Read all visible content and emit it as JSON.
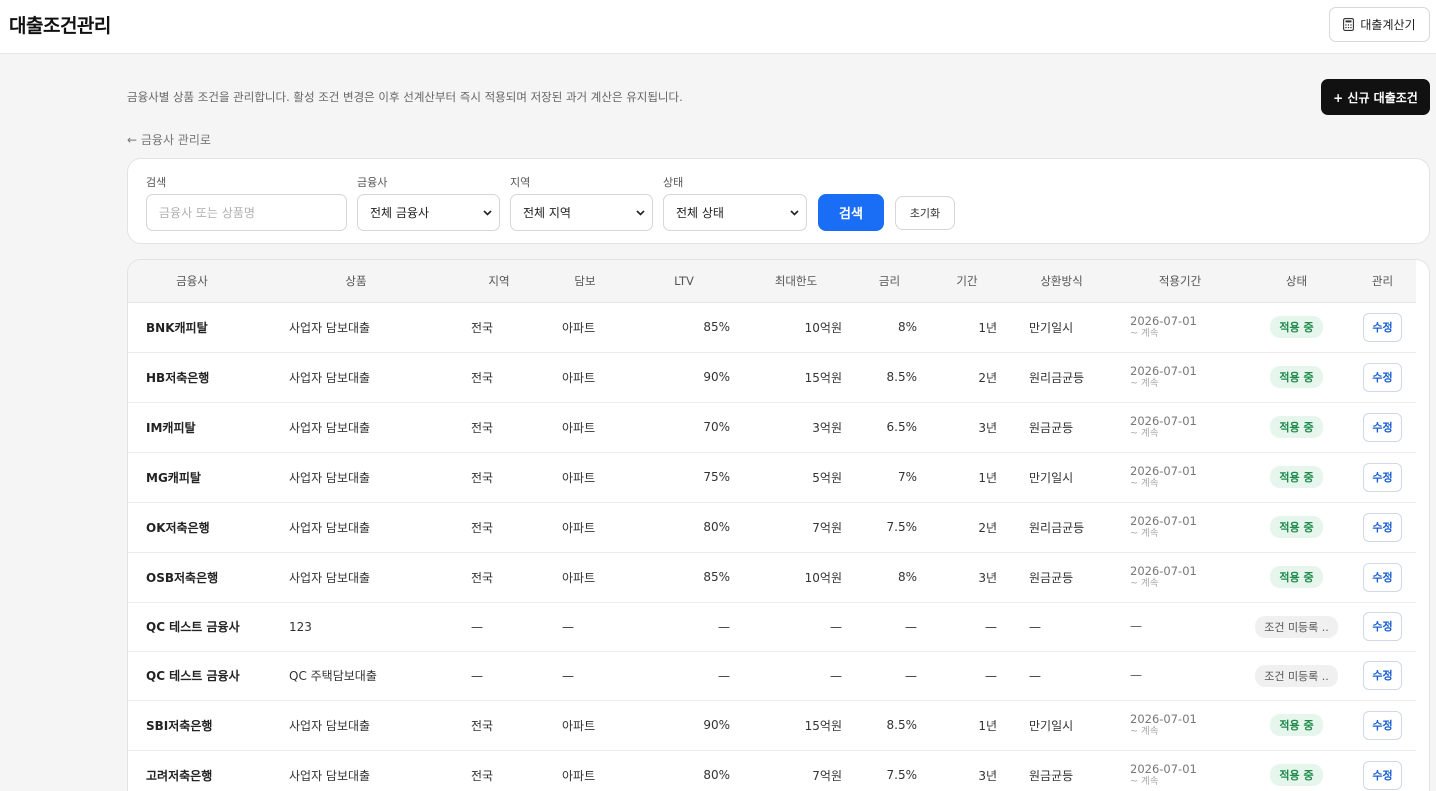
{
  "header": {
    "title": "대출조건관리",
    "calc_label": "대출계산기"
  },
  "page": {
    "description": "금융사별 상품 조건을 관리합니다. 활성 조건 변경은 이후 선계산부터 즉시 적용되며 저장된 과거 계산은 유지됩니다.",
    "new_button": "+ 신규 대출조건",
    "back_link": "← 금융사 관리로"
  },
  "filters": {
    "search_label": "검색",
    "search_placeholder": "금융사 또는 상품명",
    "lender_label": "금융사",
    "lender_value": "전체 금융사",
    "region_label": "지역",
    "region_value": "전체 지역",
    "status_label": "상태",
    "status_value": "전체 상태",
    "search_button": "검색",
    "reset_button": "초기화"
  },
  "table": {
    "headers": [
      "금융사",
      "상품",
      "지역",
      "담보",
      "LTV",
      "최대한도",
      "금리",
      "기간",
      "상환방식",
      "적용기간",
      "상태",
      "관리"
    ],
    "rows": [
      {
        "lender": "BNK캐피탈",
        "product": "사업자 담보대출",
        "region": "전국",
        "collateral": "아파트",
        "ltv": "85%",
        "limit": "10억원",
        "rate": "8%",
        "term": "1년",
        "method": "만기일시",
        "period": "2026-07-01",
        "period_sub": "~ 계속",
        "status": "적용 중",
        "active": true,
        "action": "수정"
      },
      {
        "lender": "HB저축은행",
        "product": "사업자 담보대출",
        "region": "전국",
        "collateral": "아파트",
        "ltv": "90%",
        "limit": "15억원",
        "rate": "8.5%",
        "term": "2년",
        "method": "원리금균등",
        "period": "2026-07-01",
        "period_sub": "~ 계속",
        "status": "적용 중",
        "active": true,
        "action": "수정"
      },
      {
        "lender": "IM캐피탈",
        "product": "사업자 담보대출",
        "region": "전국",
        "collateral": "아파트",
        "ltv": "70%",
        "limit": "3억원",
        "rate": "6.5%",
        "term": "3년",
        "method": "원금균등",
        "period": "2026-07-01",
        "period_sub": "~ 계속",
        "status": "적용 중",
        "active": true,
        "action": "수정"
      },
      {
        "lender": "MG캐피탈",
        "product": "사업자 담보대출",
        "region": "전국",
        "collateral": "아파트",
        "ltv": "75%",
        "limit": "5억원",
        "rate": "7%",
        "term": "1년",
        "method": "만기일시",
        "period": "2026-07-01",
        "period_sub": "~ 계속",
        "status": "적용 중",
        "active": true,
        "action": "수정"
      },
      {
        "lender": "OK저축은행",
        "product": "사업자 담보대출",
        "region": "전국",
        "collateral": "아파트",
        "ltv": "80%",
        "limit": "7억원",
        "rate": "7.5%",
        "term": "2년",
        "method": "원리금균등",
        "period": "2026-07-01",
        "period_sub": "~ 계속",
        "status": "적용 중",
        "active": true,
        "action": "수정"
      },
      {
        "lender": "OSB저축은행",
        "product": "사업자 담보대출",
        "region": "전국",
        "collateral": "아파트",
        "ltv": "85%",
        "limit": "10억원",
        "rate": "8%",
        "term": "3년",
        "method": "원금균등",
        "period": "2026-07-01",
        "period_sub": "~ 계속",
        "status": "적용 중",
        "active": true,
        "action": "수정"
      },
      {
        "lender": "QC 테스트 금융사",
        "product": "123",
        "region": "—",
        "collateral": "—",
        "ltv": "—",
        "limit": "—",
        "rate": "—",
        "term": "—",
        "method": "—",
        "period": "—",
        "period_sub": "",
        "status": "조건 미등록 ..",
        "active": false,
        "action": "수정"
      },
      {
        "lender": "QC 테스트 금융사",
        "product": "QC 주택담보대출",
        "region": "—",
        "collateral": "—",
        "ltv": "—",
        "limit": "—",
        "rate": "—",
        "term": "—",
        "method": "—",
        "period": "—",
        "period_sub": "",
        "status": "조건 미등록 ..",
        "active": false,
        "action": "수정"
      },
      {
        "lender": "SBI저축은행",
        "product": "사업자 담보대출",
        "region": "전국",
        "collateral": "아파트",
        "ltv": "90%",
        "limit": "15억원",
        "rate": "8.5%",
        "term": "1년",
        "method": "만기일시",
        "period": "2026-07-01",
        "period_sub": "~ 계속",
        "status": "적용 중",
        "active": true,
        "action": "수정"
      },
      {
        "lender": "고려저축은행",
        "product": "사업자 담보대출",
        "region": "전국",
        "collateral": "아파트",
        "ltv": "80%",
        "limit": "7억원",
        "rate": "7.5%",
        "term": "3년",
        "method": "원금균등",
        "period": "2026-07-01",
        "period_sub": "~ 계속",
        "status": "적용 중",
        "active": true,
        "action": "수정"
      }
    ]
  },
  "colors": {
    "primary": "#1a6ef5",
    "dark": "#111111",
    "active_bg": "#e6f6ec",
    "active_fg": "#1f8a4c"
  }
}
